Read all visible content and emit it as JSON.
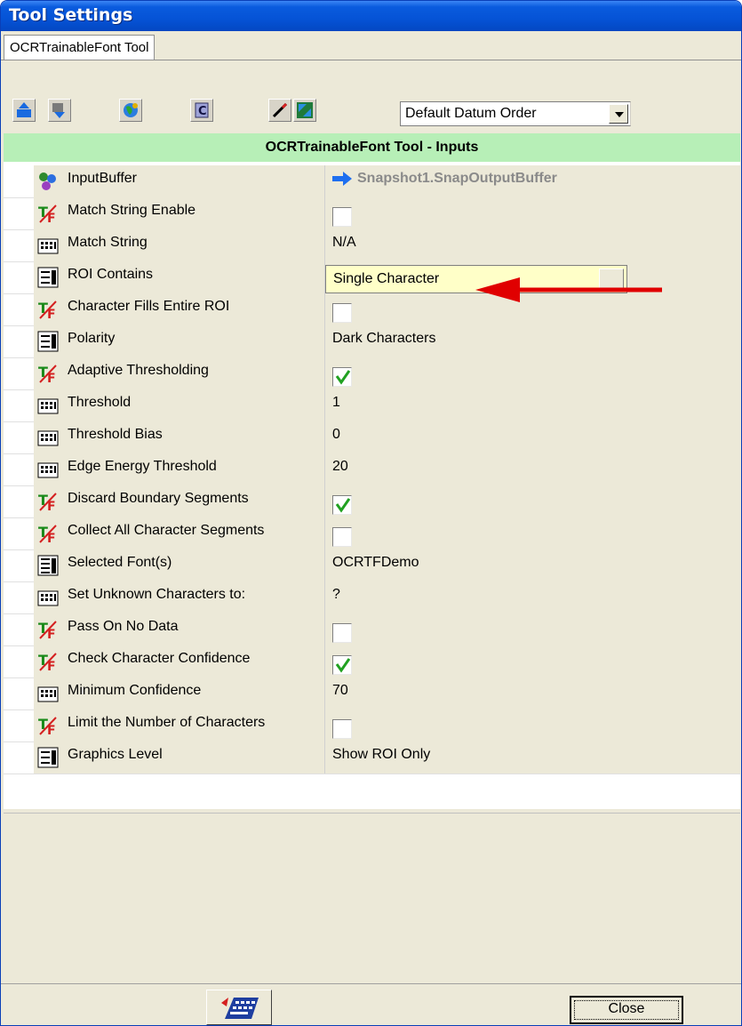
{
  "window": {
    "title": "Tool Settings"
  },
  "tabs": [
    {
      "label": "OCRTrainableFont Tool"
    }
  ],
  "toolbar": {
    "buttons": [
      "move-up-icon",
      "move-down-icon",
      "globe-icon",
      "c-icon",
      "pen-icon",
      "refresh-icon"
    ],
    "datum_order": "Default Datum Order"
  },
  "grid": {
    "header": "OCRTrainableFont Tool - Inputs",
    "rows": [
      {
        "label": "InputBuffer",
        "type": "link",
        "value": "Snapshot1.SnapOutputBuffer",
        "icon": "input-buffer-icon"
      },
      {
        "label": "Match String Enable",
        "type": "checkbox",
        "checked": false,
        "icon": "tf-icon"
      },
      {
        "label": "Match String",
        "type": "text",
        "value": "N/A",
        "icon": "keypad-icon"
      },
      {
        "label": "ROI Contains",
        "type": "dropdown",
        "value": "Single Character",
        "icon": "list-icon"
      },
      {
        "label": "Character Fills Entire ROI",
        "type": "checkbox",
        "checked": false,
        "icon": "tf-icon"
      },
      {
        "label": "Polarity",
        "type": "text",
        "value": "Dark Characters",
        "icon": "list-icon"
      },
      {
        "label": "Adaptive Thresholding",
        "type": "checkbox",
        "checked": true,
        "icon": "tf-icon"
      },
      {
        "label": "Threshold",
        "type": "text",
        "value": "1",
        "icon": "keypad-icon"
      },
      {
        "label": "Threshold Bias",
        "type": "text",
        "value": "0",
        "icon": "keypad-icon"
      },
      {
        "label": "Edge Energy Threshold",
        "type": "text",
        "value": "20",
        "icon": "keypad-icon"
      },
      {
        "label": "Discard Boundary Segments",
        "type": "checkbox",
        "checked": true,
        "icon": "tf-icon"
      },
      {
        "label": "Collect All Character Segments",
        "type": "checkbox",
        "checked": false,
        "icon": "tf-icon"
      },
      {
        "label": "Selected Font(s)",
        "type": "text",
        "value": "OCRTFDemo",
        "icon": "font-list-icon"
      },
      {
        "label": "Set Unknown Characters to:",
        "type": "text",
        "value": "?",
        "icon": "keypad-icon"
      },
      {
        "label": "Pass On No Data",
        "type": "checkbox",
        "checked": false,
        "icon": "tf-icon"
      },
      {
        "label": "Check Character Confidence",
        "type": "checkbox",
        "checked": true,
        "icon": "tf-icon"
      },
      {
        "label": "Minimum Confidence",
        "type": "text",
        "value": "70",
        "icon": "keypad-icon"
      },
      {
        "label": "Limit the Number of Characters",
        "type": "checkbox",
        "checked": false,
        "icon": "tf-icon"
      },
      {
        "label": "Graphics Level",
        "type": "text",
        "value": "Show ROI Only",
        "icon": "list-icon"
      }
    ]
  },
  "footer": {
    "close_label": "Close",
    "keyboard_icon": "keyboard-icon"
  },
  "colors": {
    "header_bg": "#b7efb7",
    "dropdown_bg": "#ffffc8",
    "annotation_arrow": "#e00000",
    "link_arrow": "#1e6ff0"
  }
}
